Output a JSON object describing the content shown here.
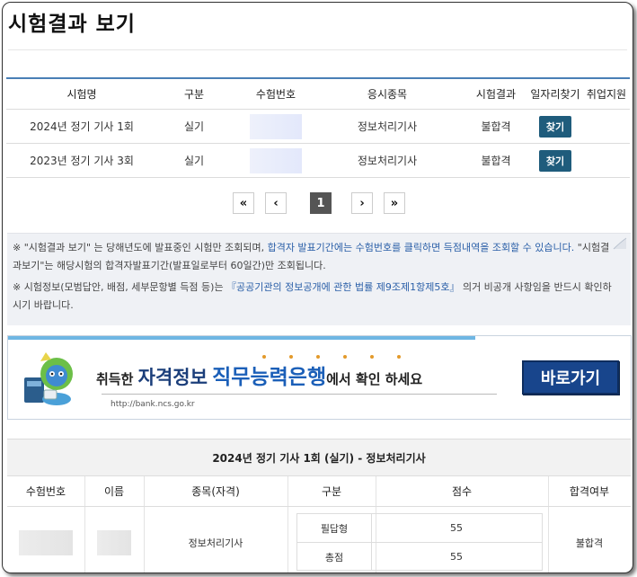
{
  "page": {
    "title": "시험결과 보기"
  },
  "results": {
    "headers": [
      "시험명",
      "구분",
      "수험번호",
      "응시종목",
      "시험결과",
      "일자리찾기",
      "취업지원"
    ],
    "rows": [
      {
        "exam": "2024년 정기 기사 1회",
        "type": "실기",
        "number": "",
        "subject": "정보처리기사",
        "result": "불합격",
        "find": "찾기",
        "support": ""
      },
      {
        "exam": "2023년 정기 기사 3회",
        "type": "실기",
        "number": "",
        "subject": "정보처리기사",
        "result": "불합격",
        "find": "찾기",
        "support": ""
      }
    ]
  },
  "pagination": {
    "first": "«",
    "prev": "‹",
    "current": "1",
    "next": "›",
    "last": "»"
  },
  "notice": {
    "mark": "※",
    "line1_a": "\"시험결과 보기\" 는 당해년도에 발표중인 시험만 조회되며, ",
    "line1_b": "합격자 발표기간에는 수험번호를 클릭하면 득점내역을 조회할 수 있습니다.",
    "line1_c": " \"시험결과보기\"는 해당시험의 합격자발표기간(발표일로부터 60일간)만 조회됩니다.",
    "line2_a": "시험정보(모범답안, 배점, 세부문항별 득점 등)는 ",
    "line2_b": "『공공기관의 정보공개에 관한 법률 제9조제1항제5호』",
    "line2_c": " 의거 비공개 사항임을 반드시 확인하시기 바랍니다."
  },
  "banner": {
    "pre": "취득한 ",
    "part1": "자격정보",
    "part2": "직무능력은행",
    "post": "에서 확인 하세요",
    "url": "http://bank.ncs.go.kr",
    "button": "바로가기"
  },
  "detail": {
    "caption": "2024년 정기 기사 1회 (실기) - 정보처리기사",
    "headers": [
      "수험번호",
      "이름",
      "종목(자격)",
      "구분",
      "점수",
      "합격여부"
    ],
    "subject": "정보처리기사",
    "scores": [
      {
        "label": "필답형",
        "value": "55"
      },
      {
        "label": "총점",
        "value": "55"
      }
    ],
    "pass": "불합격"
  }
}
